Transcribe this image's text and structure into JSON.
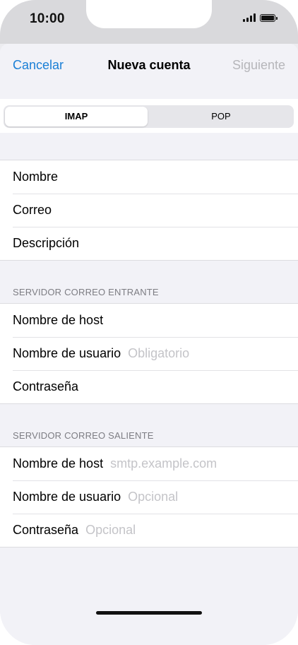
{
  "status_bar": {
    "time": "10:00",
    "signal_icon": "cellular-signal-icon",
    "battery_icon": "battery-full-icon"
  },
  "nav": {
    "cancel_label": "Cancelar",
    "title": "Nueva cuenta",
    "next_label": "Siguiente",
    "accent_color": "#1a7fd6",
    "disabled_color": "#b6b6ba"
  },
  "segmented": {
    "options": [
      "IMAP",
      "POP"
    ],
    "selected": "IMAP"
  },
  "account": {
    "rows": [
      {
        "label": "Nombre",
        "placeholder": ""
      },
      {
        "label": "Correo",
        "placeholder": ""
      },
      {
        "label": "Descripción",
        "placeholder": ""
      }
    ]
  },
  "incoming": {
    "header": "SERVIDOR CORREO ENTRANTE",
    "rows": [
      {
        "label": "Nombre de host",
        "placeholder": ""
      },
      {
        "label": "Nombre de usuario",
        "placeholder": "Obligatorio"
      },
      {
        "label": "Contraseña",
        "placeholder": ""
      }
    ]
  },
  "outgoing": {
    "header": "SERVIDOR CORREO SALIENTE",
    "rows": [
      {
        "label": "Nombre de host",
        "placeholder": "smtp.example.com"
      },
      {
        "label": "Nombre de usuario",
        "placeholder": "Opcional"
      },
      {
        "label": "Contraseña",
        "placeholder": "Opcional"
      }
    ]
  }
}
